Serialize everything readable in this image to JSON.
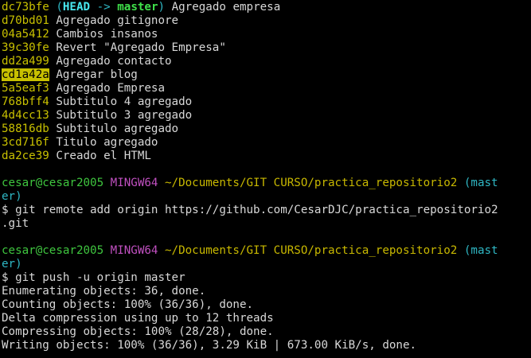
{
  "log": [
    {
      "hash": "dc73bfe",
      "decor": {
        "open": "(",
        "head": "HEAD",
        "arrow": " -> ",
        "branch": "master",
        "close": ")"
      },
      "msg": "Agregado empresa"
    },
    {
      "hash": "d70bd01",
      "msg": "Agregado gitignore"
    },
    {
      "hash": "04a5412",
      "msg": "Cambios insanos"
    },
    {
      "hash": "39c30fe",
      "msg": "Revert \"Agregado Empresa\""
    },
    {
      "hash": "dd2a499",
      "msg": "Agregado contacto"
    },
    {
      "hash": "cd1a42a",
      "msg": "Agregar blog",
      "highlight": true
    },
    {
      "hash": "5a5eaf3",
      "msg": "Agregado Empresa"
    },
    {
      "hash": "768bff4",
      "msg": "Subtitulo 4 agregado"
    },
    {
      "hash": "4d4cc13",
      "msg": "Subtitulo 3 agregado"
    },
    {
      "hash": "58816db",
      "msg": "Subtitulo agregado"
    },
    {
      "hash": "3cd716f",
      "msg": "Titulo agregado"
    },
    {
      "hash": "da2ce39",
      "msg": "Creado el HTML"
    }
  ],
  "prompt1": {
    "user": "cesar@cesar2005",
    "shell": "MINGW64",
    "path": "~/Documents/GIT CURSO/practica_repositorio2",
    "branch_a": "(mast",
    "branch_b": "er)"
  },
  "cmd1": {
    "line1": "$ git remote add origin https://github.com/CesarDJC/practica_repositorio2",
    "line2": ".git"
  },
  "prompt2": {
    "user": "cesar@cesar2005",
    "shell": "MINGW64",
    "path": "~/Documents/GIT CURSO/practica_repositorio2",
    "branch_a": "(mast",
    "branch_b": "er)"
  },
  "cmd2": "$ git push -u origin master",
  "output": [
    "Enumerating objects: 36, done.",
    "Counting objects: 100% (36/36), done.",
    "Delta compression using up to 12 threads",
    "Compressing objects: 100% (28/28), done.",
    "Writing objects: 100% (36/36), 3.29 KiB | 673.00 KiB/s, done."
  ]
}
